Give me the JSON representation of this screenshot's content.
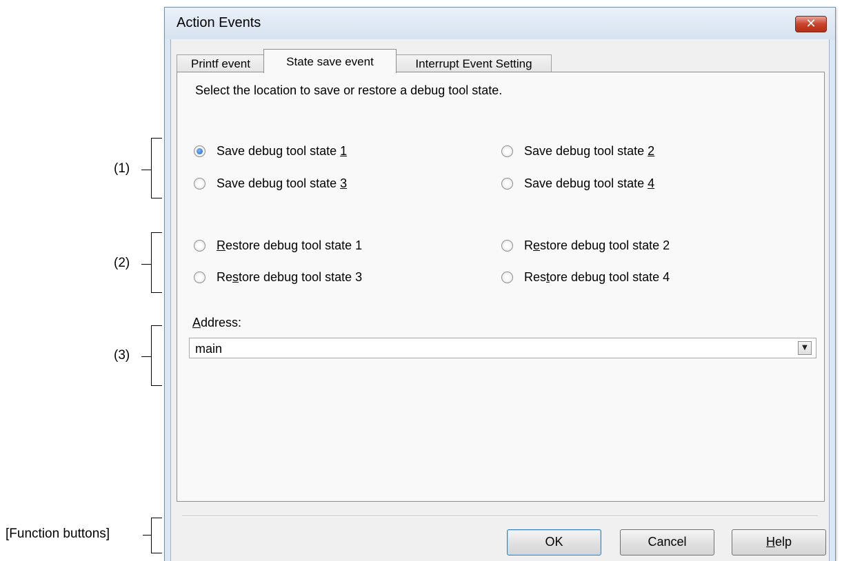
{
  "annotations": {
    "one": "(1)",
    "two": "(2)",
    "three": "(3)",
    "function_buttons": "[Function buttons]"
  },
  "window": {
    "title": "Action Events",
    "close_glyph": "✕"
  },
  "tabs": [
    {
      "label": "Printf event",
      "active": false
    },
    {
      "label": "State save event",
      "active": true
    },
    {
      "label": "Interrupt Event Setting",
      "active": false
    }
  ],
  "panel": {
    "instruction": "Select the location to save or restore a debug tool state.",
    "save_options": [
      {
        "label": "Save debug tool state ",
        "mnemonic": "1",
        "checked": true
      },
      {
        "label": "Save debug tool state ",
        "mnemonic": "2",
        "checked": false
      },
      {
        "label": "Save debug tool state ",
        "mnemonic": "3",
        "checked": false
      },
      {
        "label": "Save debug tool state ",
        "mnemonic": "4",
        "checked": false
      }
    ],
    "restore_options": [
      {
        "pre": "",
        "mnemonic": "R",
        "post": "estore debug tool state 1",
        "checked": false
      },
      {
        "pre": "R",
        "mnemonic": "e",
        "post": "store debug tool state 2",
        "checked": false
      },
      {
        "pre": "Re",
        "mnemonic": "s",
        "post": "tore debug tool state 3",
        "checked": false
      },
      {
        "pre": "Res",
        "mnemonic": "t",
        "post": "ore debug tool state 4",
        "checked": false
      }
    ],
    "address": {
      "label_mnemonic": "A",
      "label_rest": "ddress:",
      "value": "main"
    }
  },
  "buttons": {
    "ok": "OK",
    "cancel": "Cancel",
    "help_mnemonic": "H",
    "help_rest": "elp"
  },
  "icons": {
    "dropdown": "chevron-down-icon",
    "close": "close-icon"
  },
  "colors": {
    "title_bar": "#dbe7f4",
    "close_button": "#c7432b",
    "radio_selected": "#1d5fbf"
  }
}
